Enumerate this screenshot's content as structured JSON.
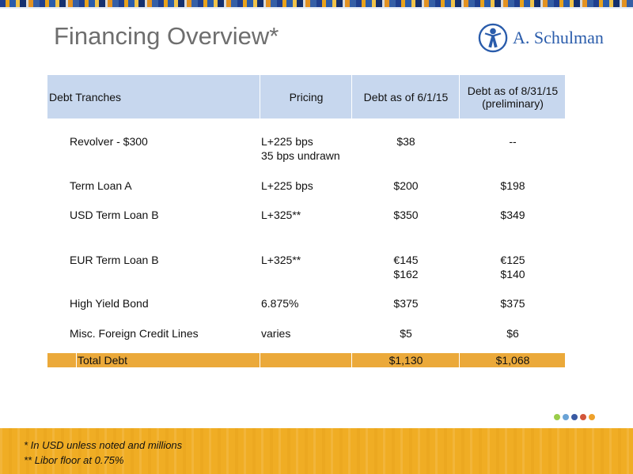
{
  "header": {
    "title": "Financing Overview*",
    "logo_text": "A. Schulman"
  },
  "table": {
    "columns": [
      "Debt Tranches",
      "Pricing",
      "Debt as of 6/1/15",
      "Debt as of 8/31/15",
      "(preliminary)"
    ],
    "rows": [
      {
        "name": "Revolver - $300",
        "pricing": [
          "L+225 bps",
          "35 bps undrawn"
        ],
        "d1": [
          "$38"
        ],
        "d2": [
          "--"
        ]
      },
      {
        "name": "Term Loan A",
        "pricing": [
          "L+225 bps"
        ],
        "d1": [
          "$200"
        ],
        "d2": [
          "$198"
        ]
      },
      {
        "name": "USD Term Loan B",
        "pricing": [
          "L+325**"
        ],
        "d1": [
          "$350"
        ],
        "d2": [
          "$349"
        ]
      },
      {
        "name": "EUR Term Loan B",
        "pricing": [
          "L+325**"
        ],
        "d1": [
          "€145",
          "$162"
        ],
        "d2": [
          "€125",
          "$140"
        ]
      },
      {
        "name": "High Yield Bond",
        "pricing": [
          "6.875%"
        ],
        "d1": [
          "$375"
        ],
        "d2": [
          "$375"
        ]
      },
      {
        "name": "Misc. Foreign Credit Lines",
        "pricing": [
          "varies"
        ],
        "d1": [
          "$5"
        ],
        "d2": [
          "$6"
        ]
      }
    ],
    "total": {
      "name": "Total Debt",
      "d1": "$1,130",
      "d2": "$1,068"
    }
  },
  "footnotes": [
    "* In USD unless noted and millions",
    "** Libor floor at 0.75%"
  ],
  "colors": {
    "header_fill": "#c7d7ee",
    "total_fill": "#eba93a",
    "footer_band": "#f0ad24",
    "brand_blue": "#2a5cab",
    "dots": [
      "#9acd4a",
      "#6aa3d6",
      "#3a5aa3",
      "#d2553a",
      "#eea12b"
    ]
  }
}
